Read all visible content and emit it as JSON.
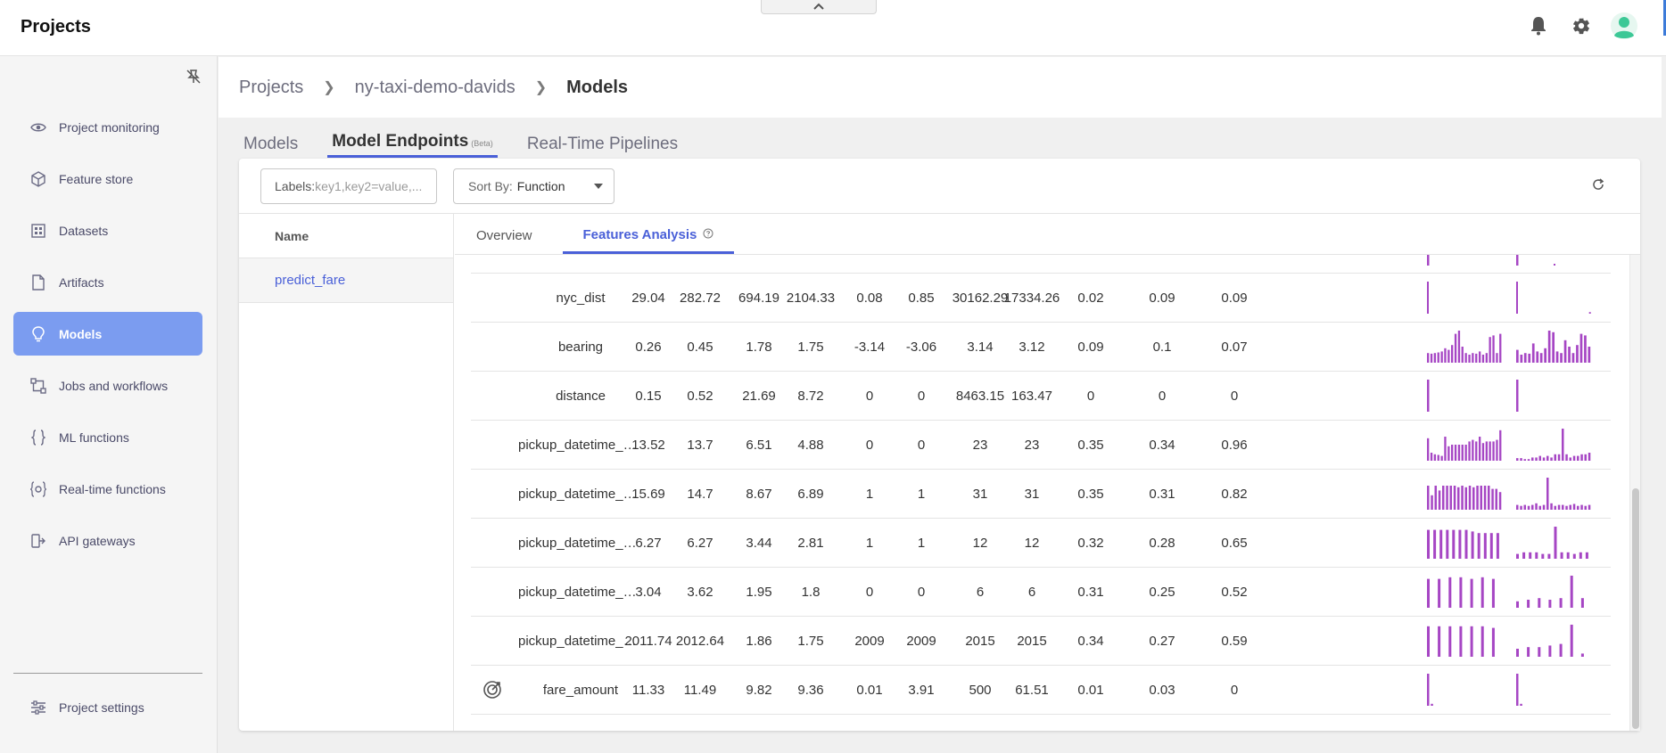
{
  "app": {
    "title": "Projects"
  },
  "sidebar": {
    "items": [
      {
        "label": "Project monitoring",
        "icon": "eye-icon",
        "active": false
      },
      {
        "label": "Feature store",
        "icon": "cube-icon",
        "active": false
      },
      {
        "label": "Datasets",
        "icon": "grid-icon",
        "active": false
      },
      {
        "label": "Artifacts",
        "icon": "file-icon",
        "active": false
      },
      {
        "label": "Models",
        "icon": "bulb-icon",
        "active": true
      },
      {
        "label": "Jobs and workflows",
        "icon": "workflow-icon",
        "active": false
      },
      {
        "label": "ML functions",
        "icon": "braces-icon",
        "active": false
      },
      {
        "label": "Real-time functions",
        "icon": "gear-braces-icon",
        "active": false
      },
      {
        "label": "API gateways",
        "icon": "gateway-icon",
        "active": false
      }
    ],
    "settings_label": "Project settings"
  },
  "breadcrumb": {
    "root": "Projects",
    "project": "ny-taxi-demo-davids",
    "current": "Models"
  },
  "tabs": [
    {
      "label": "Models",
      "active": false
    },
    {
      "label": "Model Endpoints",
      "active": true,
      "badge": "(Beta)"
    },
    {
      "label": "Real-Time Pipelines",
      "active": false
    }
  ],
  "filters": {
    "labels_prefix": "Labels:",
    "labels_placeholder": "key1,key2=value,...",
    "sort_label": "Sort By:",
    "sort_value": "Function"
  },
  "name_column": {
    "header": "Name",
    "rows": [
      "predict_fare"
    ]
  },
  "detail_tabs": [
    {
      "label": "Overview",
      "active": false
    },
    {
      "label": "Features Analysis",
      "active": true
    }
  ],
  "features": [
    {
      "name": "nyc_dist",
      "values": [
        "29.04",
        "282.72",
        "694.19",
        "2104.33",
        "0.08",
        "0.85",
        "30162.29",
        "17334.26",
        "0.02",
        "0.09",
        "0.09"
      ],
      "hist1": [
        1,
        0,
        0,
        0,
        0,
        0,
        0,
        0,
        0,
        0,
        0,
        0,
        0,
        0,
        0,
        0,
        0,
        0,
        0,
        0,
        0,
        0,
        0,
        0,
        0,
        0
      ],
      "hist2": [
        1,
        0,
        0,
        0,
        0,
        0,
        0,
        0,
        0,
        0,
        0,
        0,
        0,
        0,
        0,
        0,
        0,
        0,
        0,
        0,
        0,
        0,
        0,
        0,
        0,
        0.05
      ]
    },
    {
      "name": "bearing",
      "values": [
        "0.26",
        "0.45",
        "1.78",
        "1.75",
        "-3.14",
        "-3.06",
        "3.14",
        "3.12",
        "0.09",
        "0.1",
        "0.07"
      ],
      "hist1": [
        0.3,
        0.28,
        0.3,
        0.32,
        0.35,
        0.45,
        0.4,
        0.55,
        0.9,
        1.0,
        0.5,
        0.3,
        0.25,
        0.3,
        0.28,
        0.35,
        0.25,
        0.3,
        0.8,
        0.85,
        0.3,
        0.9
      ],
      "hist2": [
        0.4,
        0.25,
        0.3,
        0.28,
        0.6,
        0.35,
        0.3,
        0.45,
        1.0,
        0.95,
        0.35,
        0.3,
        0.7,
        0.5,
        0.3,
        0.55,
        0.9,
        0.85,
        0.5
      ]
    },
    {
      "name": "distance",
      "values": [
        "0.15",
        "0.52",
        "21.69",
        "8.72",
        "0",
        "0",
        "8463.15",
        "163.47",
        "0",
        "0",
        "0"
      ],
      "hist1": [
        1,
        0,
        0,
        0,
        0,
        0,
        0,
        0,
        0,
        0,
        0,
        0,
        0,
        0,
        0,
        0,
        0,
        0,
        0,
        0
      ],
      "hist2": [
        1,
        0,
        0,
        0,
        0,
        0,
        0,
        0,
        0,
        0,
        0,
        0,
        0,
        0,
        0,
        0,
        0,
        0,
        0,
        0
      ]
    },
    {
      "name": "pickup_datetime_hour",
      "values": [
        "13.52",
        "13.7",
        "6.51",
        "4.88",
        "0",
        "0",
        "23",
        "23",
        "0.35",
        "0.34",
        "0.96"
      ],
      "hist1": [
        0.7,
        0.25,
        0.2,
        0.18,
        0.15,
        0.75,
        0.45,
        0.5,
        0.5,
        0.5,
        0.5,
        0.5,
        0.6,
        0.65,
        0.6,
        0.75,
        0.55,
        0.6,
        0.6,
        0.6,
        0.65,
        0.95
      ],
      "hist2": [
        0.08,
        0.08,
        0.05,
        0.05,
        0.1,
        0.1,
        0.15,
        0.1,
        0.15,
        0.1,
        0.2,
        0.2,
        1.0,
        0.2,
        0.1,
        0.15,
        0.15,
        0.2,
        0.2,
        0.25
      ]
    },
    {
      "name": "pickup_datetime_day",
      "values": [
        "15.69",
        "14.7",
        "8.67",
        "6.89",
        "1",
        "1",
        "31",
        "31",
        "0.35",
        "0.31",
        "0.82"
      ],
      "hist1": [
        0.75,
        0.45,
        0.75,
        0.6,
        0.75,
        0.75,
        0.75,
        0.75,
        0.7,
        0.75,
        0.7,
        0.75,
        0.7,
        0.75,
        0.75,
        0.75,
        0.75,
        0.65,
        0.65,
        0.55
      ],
      "hist2": [
        0.15,
        0.12,
        0.15,
        0.12,
        0.15,
        0.2,
        0.12,
        0.15,
        1.0,
        0.2,
        0.12,
        0.15,
        0.15,
        0.12,
        0.15,
        0.18,
        0.12,
        0.15,
        0.12,
        0.15
      ]
    },
    {
      "name": "pickup_datetime_month",
      "values": [
        "6.27",
        "6.27",
        "3.44",
        "2.81",
        "1",
        "1",
        "12",
        "12",
        "0.32",
        "0.28",
        "0.65"
      ],
      "hist1": [
        0.9,
        0.9,
        0.9,
        0.9,
        0.9,
        0.9,
        0.9,
        0.85,
        0.8,
        0.8,
        0.8,
        0.8
      ],
      "hist2": [
        0.15,
        0.2,
        0.2,
        0.2,
        0.15,
        0.15,
        1.0,
        0.2,
        0.2,
        0.15,
        0.2,
        0.2
      ]
    },
    {
      "name": "pickup_datetime_weekday",
      "values": [
        "3.04",
        "3.62",
        "1.95",
        "1.8",
        "0",
        "0",
        "6",
        "6",
        "0.31",
        "0.25",
        "0.52"
      ],
      "hist1": [
        0.9,
        0.9,
        0.95,
        0.95,
        0.9,
        0.95,
        0.9
      ],
      "hist2": [
        0.2,
        0.25,
        0.3,
        0.25,
        0.3,
        1.0,
        0.3
      ]
    },
    {
      "name": "pickup_datetime_year",
      "values": [
        "2011.74",
        "2012.64",
        "1.86",
        "1.75",
        "2009",
        "2009",
        "2015",
        "2015",
        "0.34",
        "0.27",
        "0.59"
      ],
      "hist1": [
        0.95,
        0.95,
        0.95,
        0.95,
        0.95,
        0.95,
        0.9
      ],
      "hist2": [
        0.25,
        0.3,
        0.3,
        0.35,
        0.4,
        1.0,
        0.1
      ]
    },
    {
      "name": "fare_amount",
      "values": [
        "11.33",
        "11.49",
        "9.82",
        "9.36",
        "0.01",
        "3.91",
        "500",
        "61.51",
        "0.01",
        "0.03",
        "0"
      ],
      "label_icon": "target-icon",
      "hist1": [
        1,
        0.06,
        0,
        0,
        0,
        0,
        0,
        0,
        0,
        0,
        0,
        0,
        0,
        0,
        0,
        0,
        0,
        0,
        0,
        0
      ],
      "hist2": [
        1,
        0.06,
        0,
        0,
        0,
        0,
        0,
        0,
        0,
        0,
        0,
        0,
        0,
        0,
        0,
        0,
        0,
        0,
        0,
        0
      ]
    }
  ],
  "colors": {
    "accent": "#4a60d8",
    "histogram": "#a646c4",
    "active_nav": "#7b9cf0"
  }
}
